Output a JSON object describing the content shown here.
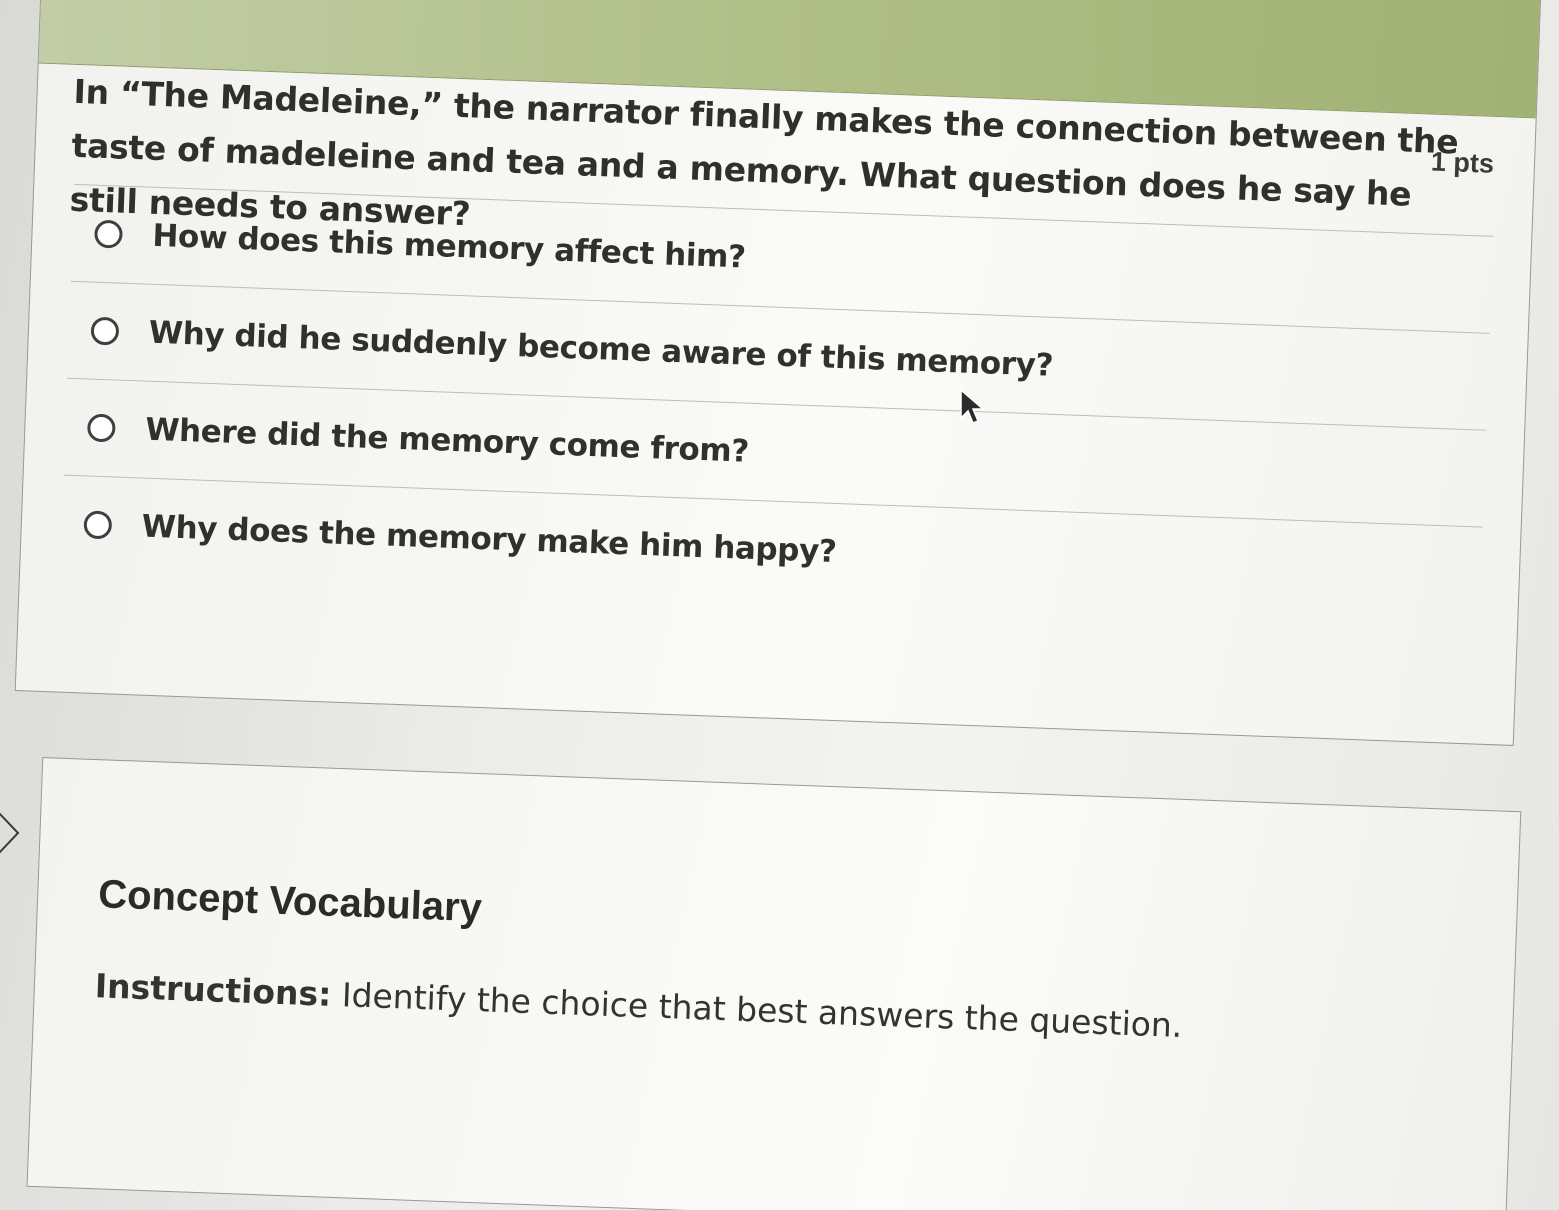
{
  "question": {
    "points": "1 pts",
    "text": "In “The Madeleine,” the narrator finally makes the connection between the taste of madeleine and tea and a memory. What question does he say he still needs to answer?",
    "answers": [
      {
        "label": "How does this memory affect him?"
      },
      {
        "label": "Why did he suddenly become aware of this memory?"
      },
      {
        "label": "Where did the memory come from?"
      },
      {
        "label": "Why does the memory make him happy?"
      }
    ]
  },
  "vocabulary": {
    "title": "Concept Vocabulary",
    "instructions_label": "Instructions:",
    "instructions_text": "Identify the choice that best answers the question."
  },
  "icons": {
    "cursor": "mouse-pointer-icon",
    "side": "chevron-right-icon"
  },
  "colors": {
    "header_green": "#aebd84",
    "text": "#2f2f2c"
  }
}
